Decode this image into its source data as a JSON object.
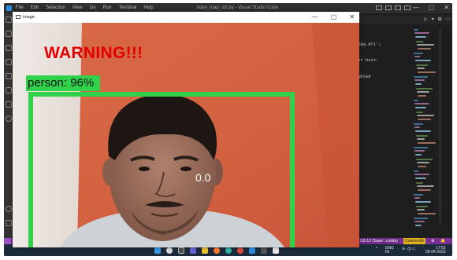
{
  "vscode": {
    "menu": [
      "File",
      "Edit",
      "Selection",
      "View",
      "Go",
      "Run",
      "Terminal",
      "Help"
    ],
    "title": "label_map_util.py - Visual Studio Code",
    "window_controls": [
      "—",
      "▢",
      "✕"
    ],
    "terminal_lines": [
      "oda.dll';",
      "or host:",
      "abled"
    ],
    "editor_actions": [
      "▷",
      "▾",
      "⊞",
      "⋯"
    ]
  },
  "status_bar": {
    "left_icons": [
      "⊗ 0",
      "⚠ 0"
    ],
    "items": [
      "3.8.12 ('base': conda)",
      "Codesmith",
      "⚙",
      "🔔"
    ]
  },
  "taskbar": {
    "icons": [
      "windows-start",
      "search",
      "task-view",
      "chat",
      "file-explorer",
      "firefox",
      "edge",
      "chrome",
      "vscode",
      "terminal",
      "notepad"
    ],
    "tray": {
      "lang": "ENG",
      "region": "IN",
      "time": "17:52",
      "date": "05-04-2023"
    }
  },
  "image_window": {
    "title": "image",
    "controls": [
      "—",
      "▢",
      "✕"
    ],
    "warning_text": "WARNING!!!",
    "detection_label": "person: 96%",
    "score_text": "0.0",
    "colors": {
      "warning": "#e30000",
      "box": "#2fd24a",
      "wall": "#d9694a"
    }
  }
}
